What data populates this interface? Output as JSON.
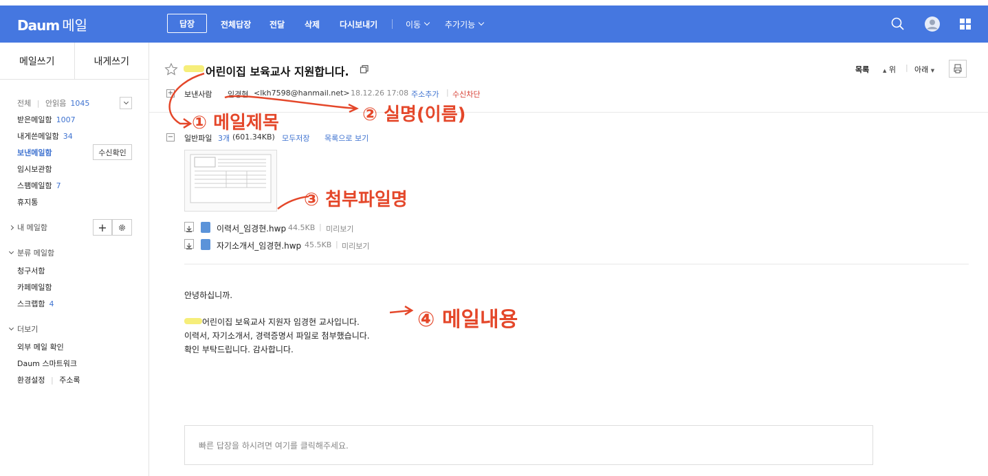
{
  "header": {
    "logo": "Daum",
    "service": "메일",
    "toolbar": {
      "reply": "답장",
      "reply_all": "전체답장",
      "forward": "전달",
      "delete": "삭제",
      "resend": "다시보내기",
      "move": "이동",
      "more": "추가기능"
    }
  },
  "sidebar": {
    "compose": "메일쓰기",
    "self_write": "내게쓰기",
    "all": "전체",
    "unread": "안읽음",
    "unread_count": "1045",
    "inbox": "받은메일함",
    "inbox_count": "1007",
    "tome": "내게쓴메일함",
    "tome_count": "34",
    "sent": "보낸메일함",
    "read_check": "수신확인",
    "drafts": "임시보관함",
    "spam": "스팸메일함",
    "spam_count": "7",
    "trash": "휴지통",
    "my_folders": "내 메일함",
    "categories": "분류 메일함",
    "cat_bills": "청구서함",
    "cat_cafe": "카페메일함",
    "cat_scrap": "스크랩함",
    "cat_scrap_count": "4",
    "more": "더보기",
    "external": "외부 메일 확인",
    "smartwork": "Daum 스마트워크",
    "settings": "환경설정",
    "contacts": "주소록"
  },
  "mail": {
    "subject": "어린이집 보육교사 지원합니다.",
    "sender_label": "보낸사람",
    "sender_name": "임경현",
    "sender_email": "<lkh7598@hanmail.net>",
    "date": "18.12.26 17:08",
    "add_contact": "주소추가",
    "block": "수신차단",
    "list": "목록",
    "up": "위",
    "down": "아래",
    "attach_label": "일반파일",
    "attach_count": "3개",
    "attach_size": "(601.34KB)",
    "save_all": "모두저장",
    "view_list": "목록으로 보기",
    "files": [
      {
        "name": "이력서_임경현.hwp",
        "size": "44.5KB",
        "preview": "미리보기"
      },
      {
        "name": "자기소개서_임경현.hwp",
        "size": "45.5KB",
        "preview": "미리보기"
      }
    ],
    "body": [
      "안녕하십니까.",
      "어린이집 보육교사 지원자 임경현 교사입니다.",
      "이력서, 자기소개서, 경력증명서 파일로 첨부했습니다.",
      "확인 부탁드립니다. 감사합니다."
    ],
    "quick_reply_placeholder": "빠른 답장을 하시려면 여기를 클릭해주세요."
  },
  "annotations": {
    "a1": "① 메일제목",
    "a2": "② 실명(이름)",
    "a3": "③ 첨부파일명",
    "a4": "④ 메일내용"
  },
  "colors": {
    "header": "#4577e0",
    "link": "#3e72d0",
    "annotation": "#e4472a"
  }
}
